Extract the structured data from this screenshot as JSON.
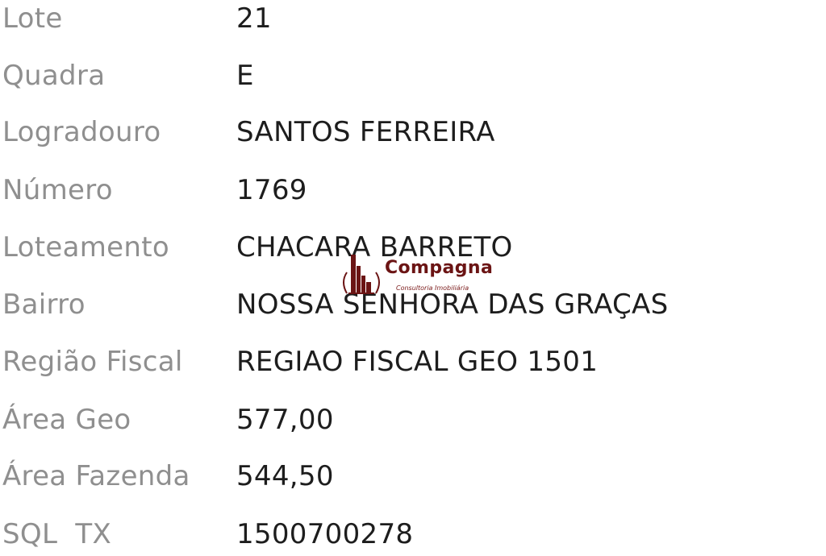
{
  "fields": [
    {
      "label": "Lote",
      "value": "21"
    },
    {
      "label": "Quadra",
      "value": "E"
    },
    {
      "label": "Logradouro",
      "value": "SANTOS FERREIRA"
    },
    {
      "label": "Número",
      "value": "1769"
    },
    {
      "label": "Loteamento",
      "value": "CHACARA BARRETO"
    },
    {
      "label": "Bairro",
      "value": "NOSSA SENHORA DAS GRAÇAS"
    },
    {
      "label": "Região Fiscal",
      "value": "REGIAO FISCAL GEO 1501"
    },
    {
      "label": "Área Geo",
      "value": "577,00"
    },
    {
      "label": "Área Fazenda",
      "value": "544,50"
    },
    {
      "label": "SQL  TX",
      "value": "1500700278"
    }
  ],
  "watermark": {
    "name": "Compagna",
    "tagline": "Consultoria Imobiliária",
    "color": "#6b1414"
  }
}
